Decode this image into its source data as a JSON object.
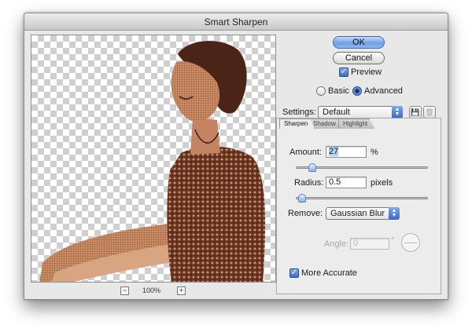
{
  "window": {
    "title": "Smart Sharpen"
  },
  "buttons": {
    "ok": "OK",
    "cancel": "Cancel"
  },
  "preview": {
    "label": "Preview",
    "checked": true,
    "zoom": "100%",
    "zoom_out": "−",
    "zoom_in": "+"
  },
  "mode": {
    "basic": "Basic",
    "advanced": "Advanced",
    "selected": "advanced"
  },
  "settings": {
    "label": "Settings:",
    "value": "Default"
  },
  "tabs": [
    {
      "label": "Sharpen",
      "active": true
    },
    {
      "label": "Shadow",
      "active": false
    },
    {
      "label": "Highlight",
      "active": false
    }
  ],
  "amount": {
    "label": "Amount:",
    "value": "27",
    "unit": "%",
    "level": 0.27
  },
  "radius": {
    "label": "Radius:",
    "value": "0.5",
    "unit": "pixels",
    "level": 0.05
  },
  "remove": {
    "label": "Remove:",
    "value": "Gaussian Blur"
  },
  "angle": {
    "label": "Angle:",
    "value": "0",
    "unit": "°",
    "disabled": true
  },
  "more_accurate": {
    "label": "More Accurate",
    "checked": true
  },
  "icons": {
    "save_settings": "disk-icon",
    "delete_settings": "trash-icon",
    "popup_arrows": "up-down-arrows-icon",
    "check": "checkmark-icon",
    "angle_dial": "angle-dial-icon"
  },
  "colors": {
    "accent": "#3f6fc4",
    "photo_tint": "#b5744c"
  }
}
